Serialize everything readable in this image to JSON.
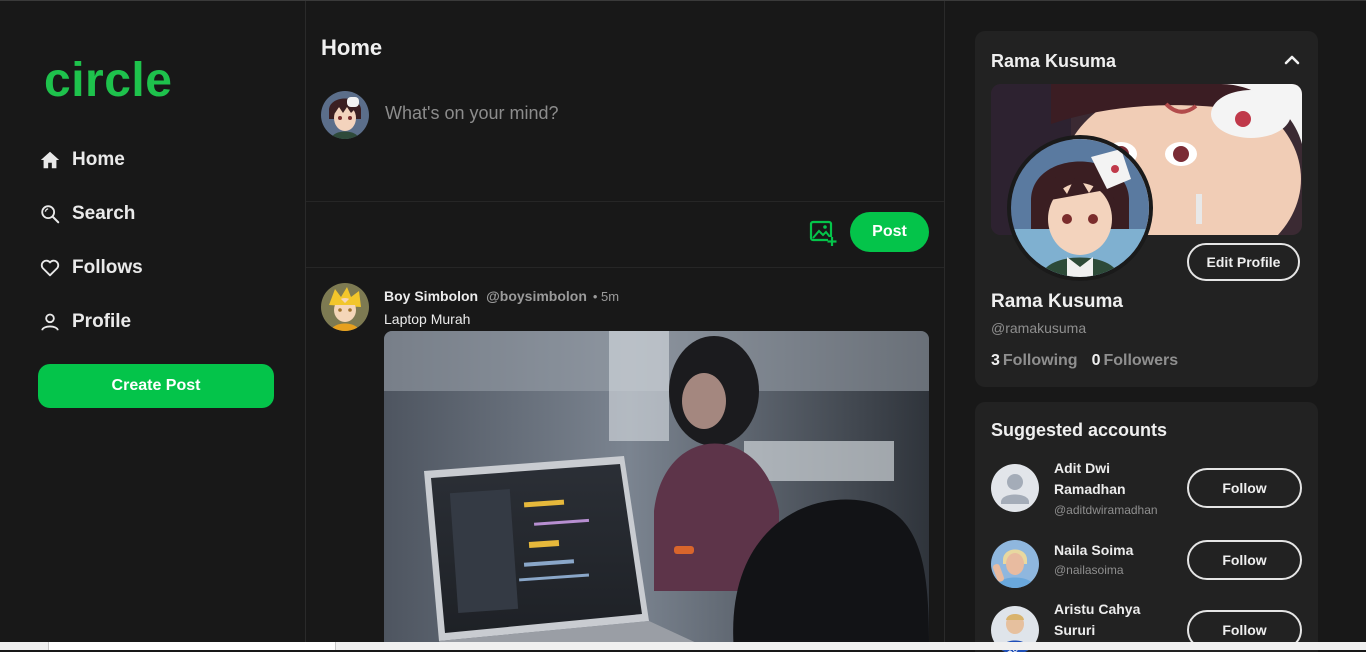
{
  "app": {
    "logo": "circle"
  },
  "nav": {
    "items": [
      {
        "label": "Home",
        "icon": "home-icon"
      },
      {
        "label": "Search",
        "icon": "search-icon"
      },
      {
        "label": "Follows",
        "icon": "heart-icon"
      },
      {
        "label": "Profile",
        "icon": "user-icon"
      }
    ],
    "create_post_label": "Create Post"
  },
  "feed": {
    "title": "Home",
    "composer": {
      "placeholder": "What's on your mind?",
      "post_label": "Post"
    },
    "posts": [
      {
        "name": "Boy Simbolon",
        "handle": "@boysimbolon",
        "time": "• 5m",
        "text": "Laptop Murah"
      }
    ]
  },
  "profile": {
    "header_name": "Rama Kusuma",
    "name": "Rama Kusuma",
    "handle": "@ramakusuma",
    "following_count": "3",
    "following_label": "Following",
    "followers_count": "0",
    "followers_label": "Followers",
    "edit_label": "Edit Profile"
  },
  "suggested": {
    "title": "Suggested accounts",
    "follow_label": "Follow",
    "accounts": [
      {
        "name": "Adit Dwi Ramadhan",
        "handle": "@aditdwiramadhan"
      },
      {
        "name": "Naila Soima",
        "handle": "@nailasoima"
      },
      {
        "name": "Aristu Cahya Sururi",
        "handle": ""
      }
    ]
  },
  "colors": {
    "accent": "#04c44a",
    "logo": "#1ec24c",
    "background": "#181818",
    "card": "#222222"
  }
}
